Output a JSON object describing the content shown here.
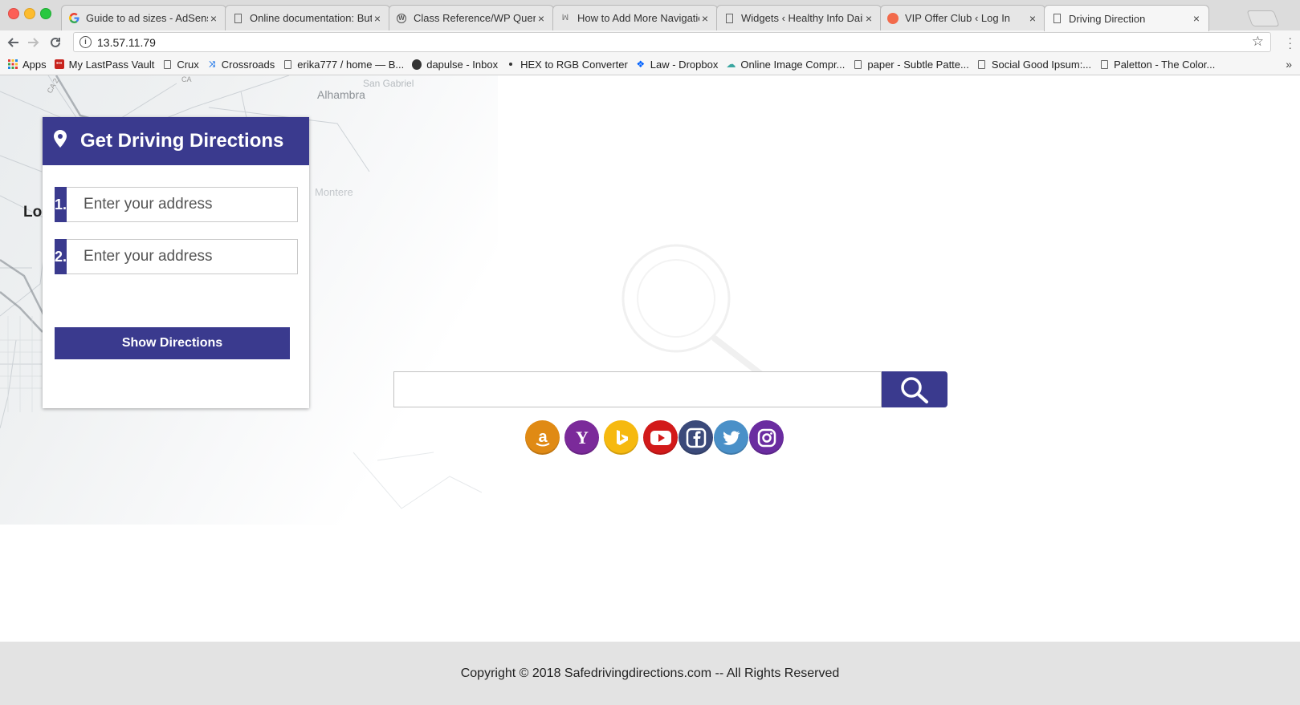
{
  "browser": {
    "tabs": [
      {
        "title": "Guide to ad sizes - AdSense",
        "favicon": "google-g"
      },
      {
        "title": "Online documentation: Butt",
        "favicon": "page"
      },
      {
        "title": "Class Reference/WP Query",
        "favicon": "wordpress"
      },
      {
        "title": "How to Add More Navigatio",
        "favicon": "wpbeginner"
      },
      {
        "title": "Widgets ‹ Healthy Info Daily",
        "favicon": "page"
      },
      {
        "title": "VIP Offer Club ‹ Log In",
        "favicon": "orange-dot"
      },
      {
        "title": "Driving Direction",
        "favicon": "page",
        "active": true
      }
    ],
    "close_glyph": "×",
    "url": "13.57.11.79",
    "info_glyph": "i",
    "bookmarks": [
      {
        "label": "Apps",
        "icon": "apps-grid-icon"
      },
      {
        "label": "My LastPass Vault",
        "icon": "lastpass-icon"
      },
      {
        "label": "Crux",
        "icon": "page-icon"
      },
      {
        "label": "Crossroads",
        "icon": "shuffle-icon"
      },
      {
        "label": "erika777 / home — B...",
        "icon": "page-icon"
      },
      {
        "label": "dapulse - Inbox",
        "icon": "dapulse-icon"
      },
      {
        "label": "HEX to RGB Converter",
        "icon": "dot-icon"
      },
      {
        "label": "Law - Dropbox",
        "icon": "dropbox-icon"
      },
      {
        "label": "Online Image Compr...",
        "icon": "cloud-icon"
      },
      {
        "label": "paper - Subtle Patte...",
        "icon": "page-icon"
      },
      {
        "label": "Social Good Ipsum:...",
        "icon": "page-icon"
      },
      {
        "label": "Paletton - The Color...",
        "icon": "page-icon"
      }
    ],
    "more_glyph": "»"
  },
  "map": {
    "labels": [
      "Alhambra",
      "San Gabriel",
      "Montere",
      "Lo",
      "CA 2",
      "CA"
    ]
  },
  "directions": {
    "title": "Get Driving Directions",
    "rows": [
      {
        "number": "1.",
        "placeholder": "Enter your address"
      },
      {
        "number": "2.",
        "placeholder": "Enter your address"
      }
    ],
    "button_label": "Show Directions"
  },
  "search": {
    "value": "",
    "placeholder": ""
  },
  "social": [
    {
      "name": "amazon",
      "color": "#e08a14",
      "glyph": "a"
    },
    {
      "name": "yahoo",
      "color": "#7b2a9a",
      "glyph": "Y"
    },
    {
      "name": "bing",
      "color": "#f6b90f",
      "glyph": "b"
    },
    {
      "name": "youtube",
      "color": "#d21a1a",
      "glyph": "▶"
    },
    {
      "name": "facebook",
      "color": "#3b4a7a",
      "glyph": "f"
    },
    {
      "name": "twitter",
      "color": "#4a90c8",
      "glyph": "t"
    },
    {
      "name": "instagram",
      "color": "#6a2ca0",
      "glyph": "◎"
    }
  ],
  "colors": {
    "primary": "#3a3a8e",
    "footer_bg": "#e3e3e3"
  },
  "footer": {
    "text": "Copyright © 2018 Safedrivingdirections.com -- All Rights Reserved"
  }
}
